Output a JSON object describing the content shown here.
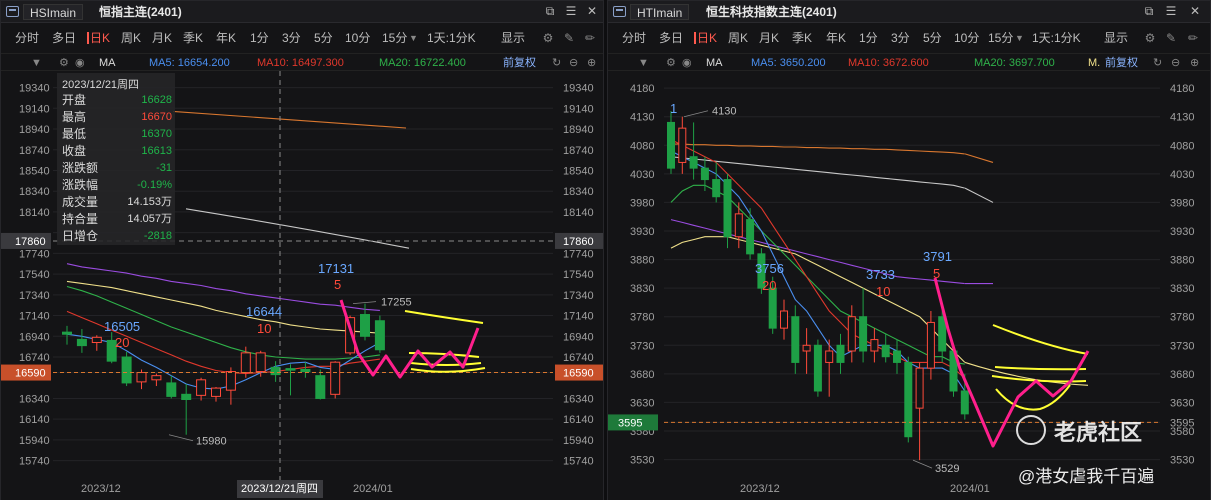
{
  "colors": {
    "up": "#ff4a3a",
    "down": "#1ea046",
    "ma5": "#4a8ff0",
    "ma10": "#e0382c",
    "ma20": "#2fb24a",
    "ma30": "#f0e08a",
    "ma60": "#9a4ce0",
    "ma120": "#c8c8c8",
    "ma250": "#d9772f",
    "draw": "#ff1f8c",
    "yellow": "#ffff33"
  },
  "toolbar": {
    "timeframes": [
      "分时",
      "多日",
      "日K",
      "周K",
      "月K",
      "季K",
      "年K",
      "1分",
      "3分",
      "5分",
      "10分",
      "15分"
    ],
    "active": "日K",
    "range": "1天:1分K",
    "display": "显示"
  },
  "left": {
    "tab": "HSImain",
    "contract_title": "恒指主连(2401)",
    "ma_bar": {
      "type": "MA",
      "ma5": "MA5: 16654.200",
      "ma10": "MA10: 16497.300",
      "ma20": "MA20: 16722.400",
      "adj": "前复权"
    },
    "crosshair_price": "17860",
    "last_price": "16590",
    "x_labels": [
      "2023/12",
      "2023/12/21周四",
      "2024/01"
    ],
    "annotations": {
      "a1": "16505",
      "a1n": "20",
      "a2": "16644",
      "a2n": "10",
      "a3": "17131",
      "a3n": "5",
      "hi": "17255",
      "lo": "15980"
    },
    "info": {
      "date": "2023/12/21周四",
      "rows": [
        {
          "k": "开盘",
          "v": "16628"
        },
        {
          "k": "最高",
          "v": "16670"
        },
        {
          "k": "最低",
          "v": "16370"
        },
        {
          "k": "收盘",
          "v": "16613"
        },
        {
          "k": "涨跌额",
          "v": "-31"
        },
        {
          "k": "涨跌幅",
          "v": "-0.19%"
        },
        {
          "k": "成交量",
          "v": "14.153万"
        },
        {
          "k": "持合量",
          "v": "14.057万"
        },
        {
          "k": "日增仓",
          "v": "-2818"
        }
      ]
    }
  },
  "right": {
    "tab": "HTImain",
    "contract_title": "恒生科技指数主连(2401)",
    "ma_bar": {
      "type": "MA",
      "ma5": "MA5: 3650.200",
      "ma10": "MA10: 3672.600",
      "ma20": "MA20: 3697.700",
      "extra": "M.",
      "adj": "前复权"
    },
    "last_price": "3595",
    "x_labels": [
      "2023/12",
      "2024/01"
    ],
    "annotations": {
      "a0": "1",
      "hi": "4130",
      "a1": "3756",
      "a1n": "20",
      "a2": "3733",
      "a2n": "10",
      "a3": "3791",
      "a3n": "5",
      "lo": "3529"
    }
  },
  "watermark": {
    "text": "老虎社区",
    "author": "@港女虐我千百遍"
  },
  "chart_data": [
    {
      "type": "candlestick",
      "title": "恒指主连(2401)",
      "ylim": [
        15640,
        19500
      ],
      "y_ticks": [
        19340,
        19140,
        18940,
        18740,
        18540,
        18340,
        18140,
        17940,
        17740,
        17540,
        17340,
        17140,
        16940,
        16740,
        16590,
        16340,
        16140,
        15940,
        15740
      ],
      "candles": [
        {
          "o": 16980,
          "h": 17040,
          "l": 16860,
          "c": 16960
        },
        {
          "o": 16910,
          "h": 17010,
          "l": 16780,
          "c": 16850
        },
        {
          "o": 16880,
          "h": 16950,
          "l": 16800,
          "c": 16930
        },
        {
          "o": 16900,
          "h": 16980,
          "l": 16680,
          "c": 16700
        },
        {
          "o": 16740,
          "h": 16790,
          "l": 16460,
          "c": 16490
        },
        {
          "o": 16500,
          "h": 16620,
          "l": 16430,
          "c": 16590
        },
        {
          "o": 16520,
          "h": 16580,
          "l": 16460,
          "c": 16560
        },
        {
          "o": 16490,
          "h": 16560,
          "l": 16340,
          "c": 16360
        },
        {
          "o": 16380,
          "h": 16480,
          "l": 15990,
          "c": 16330
        },
        {
          "o": 16370,
          "h": 16540,
          "l": 16320,
          "c": 16520
        },
        {
          "o": 16360,
          "h": 16450,
          "l": 16310,
          "c": 16440
        },
        {
          "o": 16420,
          "h": 16640,
          "l": 16280,
          "c": 16600
        },
        {
          "o": 16590,
          "h": 16840,
          "l": 16540,
          "c": 16780
        },
        {
          "o": 16600,
          "h": 16800,
          "l": 16550,
          "c": 16780
        },
        {
          "o": 16640,
          "h": 16700,
          "l": 16500,
          "c": 16570
        },
        {
          "o": 16628,
          "h": 16670,
          "l": 16370,
          "c": 16613
        },
        {
          "o": 16620,
          "h": 16690,
          "l": 16540,
          "c": 16600
        },
        {
          "o": 16560,
          "h": 16620,
          "l": 16330,
          "c": 16340
        },
        {
          "o": 16380,
          "h": 16700,
          "l": 16340,
          "c": 16690
        },
        {
          "o": 16780,
          "h": 17140,
          "l": 16760,
          "c": 17120
        },
        {
          "o": 17150,
          "h": 17255,
          "l": 16900,
          "c": 16940
        },
        {
          "o": 17090,
          "h": 17140,
          "l": 16780,
          "c": 16810
        }
      ],
      "ma": {
        "ma5": [
          16960,
          16940,
          16910,
          16880,
          16800,
          16710,
          16640,
          16560,
          16480,
          16440,
          16430,
          16460,
          16520,
          16590,
          16650,
          16680,
          16690,
          16640,
          16620,
          16710,
          16800,
          16880
        ],
        "ma10": [
          17180,
          17120,
          17060,
          17000,
          16940,
          16880,
          16820,
          16760,
          16700,
          16650,
          16610,
          16590,
          16580,
          16590,
          16600,
          16620,
          16640,
          16650,
          16650,
          16680,
          16700,
          16720
        ],
        "ma20": [
          17420,
          17380,
          17330,
          17270,
          17210,
          17150,
          17090,
          17030,
          16980,
          16930,
          16880,
          16830,
          16790,
          16760,
          16740,
          16730,
          16720,
          16720,
          16720,
          16730,
          16740,
          16760
        ],
        "ma60": [
          17640,
          17610,
          17590,
          17570,
          17550,
          17520,
          17500,
          17470,
          17450,
          17430,
          17400,
          17380,
          17350,
          17330,
          17310,
          17290,
          17270,
          17250,
          17240,
          17220,
          17200,
          17190
        ],
        "ma30": [
          17470,
          17450,
          17430,
          17410,
          17380,
          17350,
          17320,
          17290,
          17260,
          17230,
          17190,
          17160,
          17130,
          17100,
          17080,
          17050,
          17030,
          17010,
          17000,
          16990,
          16980,
          16970
        ]
      }
    },
    {
      "type": "candlestick",
      "title": "恒生科技指数主连(2401)",
      "ylim": [
        3510,
        4210
      ],
      "y_ticks": [
        4180,
        4130,
        4080,
        4030,
        3980,
        3930,
        3880,
        3830,
        3780,
        3730,
        3680,
        3630,
        3595,
        3580,
        3530
      ],
      "candles": [
        {
          "o": 4120,
          "h": 4140,
          "l": 4030,
          "c": 4040
        },
        {
          "o": 4050,
          "h": 4130,
          "l": 4030,
          "c": 4110
        },
        {
          "o": 4060,
          "h": 4120,
          "l": 4020,
          "c": 4040
        },
        {
          "o": 4040,
          "h": 4060,
          "l": 4000,
          "c": 4020
        },
        {
          "o": 4020,
          "h": 4050,
          "l": 3980,
          "c": 3990
        },
        {
          "o": 4020,
          "h": 4030,
          "l": 3900,
          "c": 3920
        },
        {
          "o": 3920,
          "h": 3980,
          "l": 3900,
          "c": 3960
        },
        {
          "o": 3950,
          "h": 3970,
          "l": 3880,
          "c": 3890
        },
        {
          "o": 3890,
          "h": 3900,
          "l": 3820,
          "c": 3830
        },
        {
          "o": 3830,
          "h": 3850,
          "l": 3750,
          "c": 3760
        },
        {
          "o": 3760,
          "h": 3810,
          "l": 3740,
          "c": 3790
        },
        {
          "o": 3780,
          "h": 3800,
          "l": 3680,
          "c": 3700
        },
        {
          "o": 3720,
          "h": 3760,
          "l": 3680,
          "c": 3730
        },
        {
          "o": 3730,
          "h": 3740,
          "l": 3640,
          "c": 3650
        },
        {
          "o": 3700,
          "h": 3740,
          "l": 3640,
          "c": 3720
        },
        {
          "o": 3730,
          "h": 3750,
          "l": 3680,
          "c": 3700
        },
        {
          "o": 3720,
          "h": 3800,
          "l": 3700,
          "c": 3780
        },
        {
          "o": 3780,
          "h": 3830,
          "l": 3700,
          "c": 3720
        },
        {
          "o": 3720,
          "h": 3760,
          "l": 3700,
          "c": 3740
        },
        {
          "o": 3730,
          "h": 3750,
          "l": 3700,
          "c": 3710
        },
        {
          "o": 3720,
          "h": 3740,
          "l": 3680,
          "c": 3700
        },
        {
          "o": 3700,
          "h": 3710,
          "l": 3560,
          "c": 3570
        },
        {
          "o": 3620,
          "h": 3700,
          "l": 3529,
          "c": 3690
        },
        {
          "o": 3690,
          "h": 3790,
          "l": 3670,
          "c": 3770
        },
        {
          "o": 3780,
          "h": 3791,
          "l": 3700,
          "c": 3720
        },
        {
          "o": 3720,
          "h": 3730,
          "l": 3640,
          "c": 3650
        },
        {
          "o": 3650,
          "h": 3680,
          "l": 3600,
          "c": 3610
        }
      ],
      "ma": {
        "ma5": [
          4070,
          4060,
          4050,
          4040,
          4030,
          4010,
          3990,
          3960,
          3930,
          3890,
          3850,
          3810,
          3790,
          3760,
          3730,
          3710,
          3720,
          3730,
          3730,
          3730,
          3720,
          3700,
          3690,
          3690,
          3690,
          3680,
          3650
        ],
        "ma10": [
          4090,
          4080,
          4070,
          4060,
          4050,
          4030,
          4010,
          3990,
          3970,
          3940,
          3910,
          3880,
          3850,
          3820,
          3790,
          3770,
          3750,
          3740,
          3730,
          3720,
          3710,
          3700,
          3700,
          3700,
          3700,
          3690,
          3672
        ],
        "ma20": [
          3980,
          4000,
          4010,
          4010,
          4000,
          3990,
          3970,
          3950,
          3930,
          3910,
          3890,
          3870,
          3850,
          3830,
          3810,
          3790,
          3780,
          3770,
          3760,
          3750,
          3740,
          3730,
          3720,
          3710,
          3710,
          3700,
          3697
        ],
        "ma30": [
          3900,
          3910,
          3915,
          3920,
          3920,
          3920,
          3915,
          3910,
          3905,
          3900,
          3895,
          3890,
          3880,
          3870,
          3860,
          3850,
          3840,
          3830,
          3820,
          3810,
          3800,
          3790,
          3780,
          3760,
          3740,
          3720,
          3700
        ],
        "ma60": [
          3950,
          3945,
          3940,
          3935,
          3930,
          3925,
          3920,
          3915,
          3910,
          3905,
          3900,
          3895,
          3890,
          3885,
          3880,
          3875,
          3870,
          3865,
          3860,
          3855,
          3850,
          3848,
          3846,
          3844,
          3842,
          3840,
          3838
        ],
        "ma120": [
          4060,
          4058,
          4056,
          4054,
          4052,
          4050,
          4048,
          4046,
          4044,
          4042,
          4040,
          4038,
          4036,
          4034,
          4032,
          4030,
          4028,
          4026,
          4024,
          4022,
          4020,
          4018,
          4016,
          4014,
          4012,
          4010,
          4005
        ],
        "ma250": [
          4082,
          4082,
          4081,
          4081,
          4080,
          4080,
          4079,
          4079,
          4078,
          4078,
          4077,
          4077,
          4076,
          4076,
          4075,
          4075,
          4074,
          4074,
          4073,
          4073,
          4072,
          4071,
          4070,
          4069,
          4068,
          4067,
          4065
        ]
      }
    }
  ]
}
